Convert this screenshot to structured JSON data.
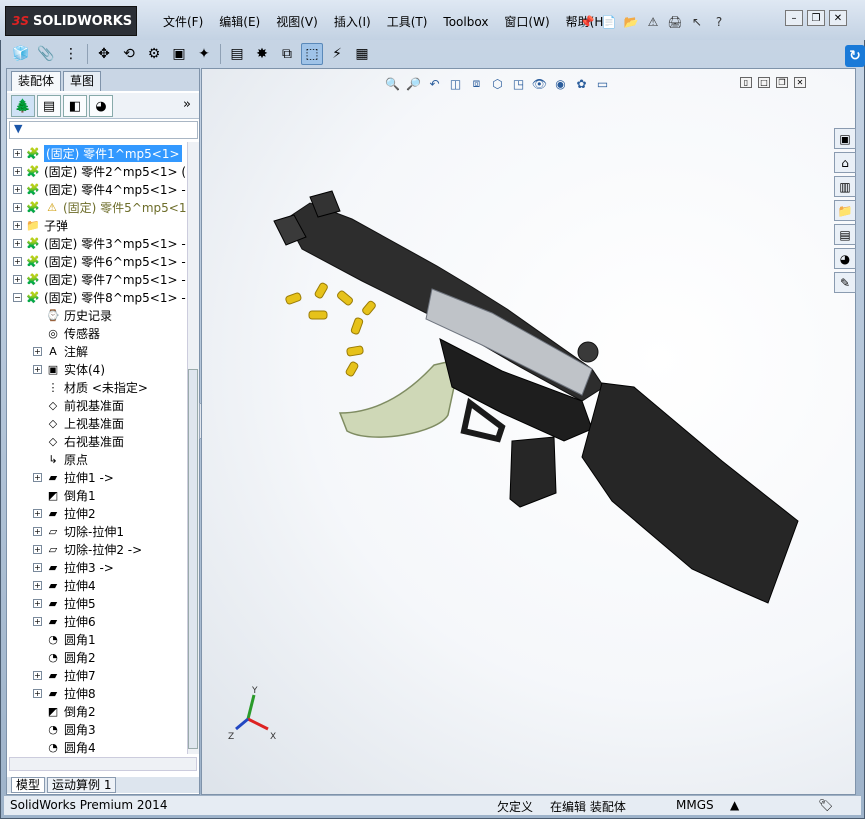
{
  "app": {
    "name": "SOLIDWORKS",
    "menus": [
      "文件(F)",
      "编辑(E)",
      "视图(V)",
      "插入(I)",
      "工具(T)",
      "Toolbox",
      "窗口(W)",
      "帮助(H)"
    ]
  },
  "left_tabs": [
    "装配体",
    "草图"
  ],
  "tree": [
    {
      "label": "(固定) 零件1^mp5<1>",
      "icon": "part-icon",
      "selected": true
    },
    {
      "label": "(固定) 零件2^mp5<1> (",
      "icon": "part-icon"
    },
    {
      "label": "(固定) 零件4^mp5<1> -",
      "icon": "part-icon"
    },
    {
      "label": "(固定) 零件5^mp5<1",
      "icon": "part-icon",
      "warning": true
    },
    {
      "label": "子弹",
      "icon": "folder-icon"
    },
    {
      "label": "(固定) 零件3^mp5<1> -",
      "icon": "part-icon"
    },
    {
      "label": "(固定) 零件6^mp5<1> -",
      "icon": "part-icon"
    },
    {
      "label": "(固定) 零件7^mp5<1> -",
      "icon": "part-icon"
    },
    {
      "label": "(固定) 零件8^mp5<1> -",
      "icon": "part-icon",
      "expanded": true
    },
    {
      "label": "历史记录",
      "icon": "history-icon",
      "indent": 1
    },
    {
      "label": "传感器",
      "icon": "sensor-icon",
      "indent": 1
    },
    {
      "label": "注解",
      "icon": "annotation-icon",
      "indent": 1,
      "exp": true
    },
    {
      "label": "实体(4)",
      "icon": "solid-bodies-icon",
      "indent": 1,
      "exp": true
    },
    {
      "label": "材质 <未指定>",
      "icon": "material-icon",
      "indent": 1
    },
    {
      "label": "前视基准面",
      "icon": "plane-icon",
      "indent": 1
    },
    {
      "label": "上视基准面",
      "icon": "plane-icon",
      "indent": 1
    },
    {
      "label": "右视基准面",
      "icon": "plane-icon",
      "indent": 1
    },
    {
      "label": "原点",
      "icon": "origin-icon",
      "indent": 1
    },
    {
      "label": "拉伸1 ->",
      "icon": "extrude-icon",
      "indent": 1,
      "exp": true
    },
    {
      "label": "倒角1",
      "icon": "chamfer-icon",
      "indent": 1
    },
    {
      "label": "拉伸2",
      "icon": "extrude-icon",
      "indent": 1,
      "exp": true
    },
    {
      "label": "切除-拉伸1",
      "icon": "cut-extrude-icon",
      "indent": 1,
      "exp": true
    },
    {
      "label": "切除-拉伸2 ->",
      "icon": "cut-extrude-icon",
      "indent": 1,
      "exp": true
    },
    {
      "label": "拉伸3 ->",
      "icon": "extrude-icon",
      "indent": 1,
      "exp": true
    },
    {
      "label": "拉伸4",
      "icon": "extrude-icon",
      "indent": 1,
      "exp": true
    },
    {
      "label": "拉伸5",
      "icon": "extrude-icon",
      "indent": 1,
      "exp": true
    },
    {
      "label": "拉伸6",
      "icon": "extrude-icon",
      "indent": 1,
      "exp": true
    },
    {
      "label": "圆角1",
      "icon": "fillet-icon",
      "indent": 1
    },
    {
      "label": "圆角2",
      "icon": "fillet-icon",
      "indent": 1
    },
    {
      "label": "拉伸7",
      "icon": "extrude-icon",
      "indent": 1,
      "exp": true
    },
    {
      "label": "拉伸8",
      "icon": "extrude-icon",
      "indent": 1,
      "exp": true
    },
    {
      "label": "倒角2",
      "icon": "chamfer-icon",
      "indent": 1
    },
    {
      "label": "圆角3",
      "icon": "fillet-icon",
      "indent": 1
    },
    {
      "label": "圆角4",
      "icon": "fillet-icon",
      "indent": 1
    }
  ],
  "bottom_tabs": [
    "模型",
    "运动算例 1"
  ],
  "status": {
    "product": "SolidWorks Premium 2014",
    "definition": "欠定义",
    "mode": "在编辑 装配体",
    "units": "MMGS"
  },
  "colors": {
    "selection": "#3399ff",
    "accent": "#1a7ad8"
  }
}
